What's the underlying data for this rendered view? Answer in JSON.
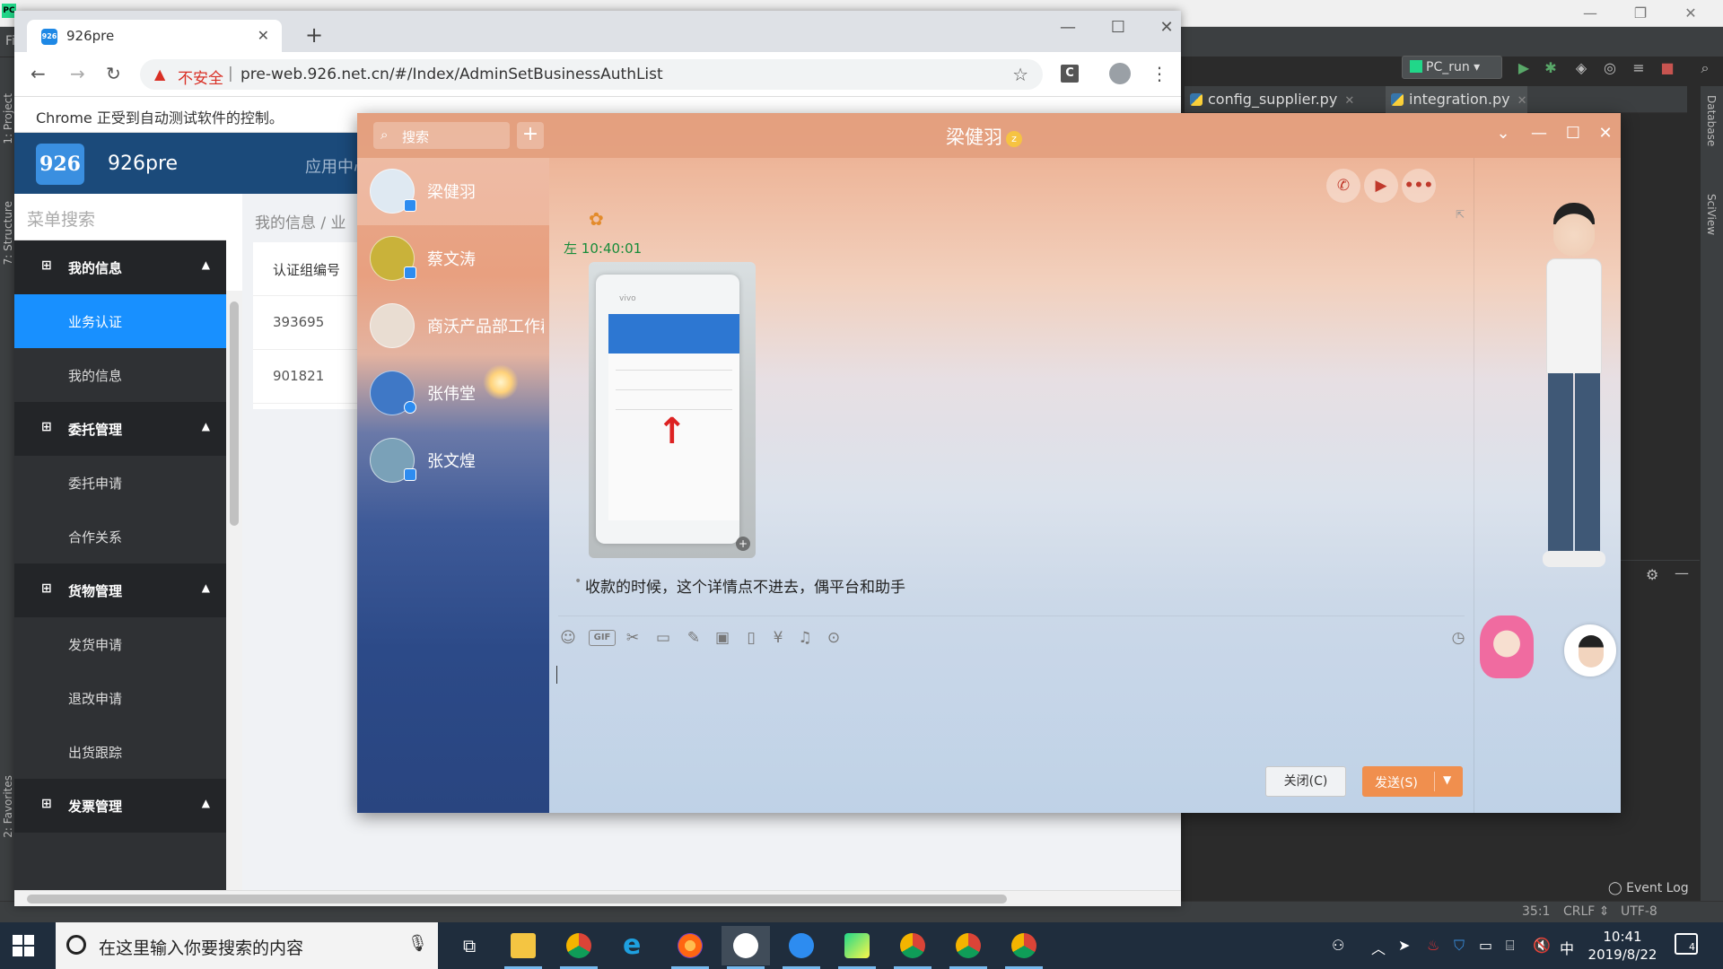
{
  "ide": {
    "menu_label": "Fi",
    "run_config": "PC_run",
    "tabs": [
      {
        "label": "config_supplier.py"
      },
      {
        "label": "integration.py"
      }
    ],
    "left_strip": {
      "project": "1: Project",
      "structure": "7: Structure",
      "favorites": "2: Favorites"
    },
    "right_strip": {
      "database": "Database",
      "sciview": "SciView"
    },
    "status": {
      "position": "35:1",
      "line_sep": "CRLF ⇕",
      "encoding": "UTF-8"
    },
    "event_log": "Event Log"
  },
  "chrome": {
    "tab_title": "926pre",
    "favicon_text": "926",
    "insecure_label": "不安全",
    "url": "pre-web.926.net.cn/#/Index/AdminSetBusinessAuthList",
    "ext_label": "C",
    "infobar": "Chrome 正受到自动测试软件的控制。"
  },
  "app": {
    "logo_text": "926",
    "name": "926pre",
    "nav_item": "应用中心",
    "menu_search_placeholder": "菜单搜索",
    "menu": [
      {
        "label": "我的信息",
        "type": "group"
      },
      {
        "label": "业务认证",
        "type": "item",
        "active": true
      },
      {
        "label": "我的信息",
        "type": "item"
      },
      {
        "label": "委托管理",
        "type": "group"
      },
      {
        "label": "委托申请",
        "type": "item"
      },
      {
        "label": "合作关系",
        "type": "item"
      },
      {
        "label": "货物管理",
        "type": "group"
      },
      {
        "label": "发货申请",
        "type": "item"
      },
      {
        "label": "退改申请",
        "type": "item"
      },
      {
        "label": "出货跟踪",
        "type": "item"
      },
      {
        "label": "发票管理",
        "type": "group"
      }
    ],
    "breadcrumb": "我的信息  /  业",
    "table": {
      "header": "认证组编号",
      "rows": [
        "393695",
        "901821"
      ]
    }
  },
  "qq": {
    "search_placeholder": "搜索",
    "chat_title": "梁健羽",
    "vip_badge": "z",
    "contacts": [
      {
        "name": "梁健羽",
        "active": true,
        "avatar_color": "#dfe9f2"
      },
      {
        "name": "蔡文涛",
        "active": false,
        "avatar_color": "#c9b23a"
      },
      {
        "name": "商沃产品部工作群",
        "active": false,
        "avatar_color": "#e9ddd2"
      },
      {
        "name": "张伟堂",
        "active": false,
        "avatar_color": "#3f78c6"
      },
      {
        "name": "张文煌",
        "active": false,
        "avatar_color": "#7aa1b8"
      }
    ],
    "message": {
      "sender_short": "左",
      "time": "10:40:01",
      "phone_brand": "vivo",
      "text": "收款的时候，这个详情点不进去，偶平台和助手"
    },
    "buttons": {
      "close": "关闭(C)",
      "send": "发送(S)"
    },
    "colors": {
      "send": "#f08f4e",
      "title_bar": "#e29e7d"
    }
  },
  "taskbar": {
    "search_placeholder": "在这里输入你要搜索的内容",
    "time": "10:41",
    "date": "2019/8/22",
    "ime": "中",
    "notifications": "4"
  }
}
